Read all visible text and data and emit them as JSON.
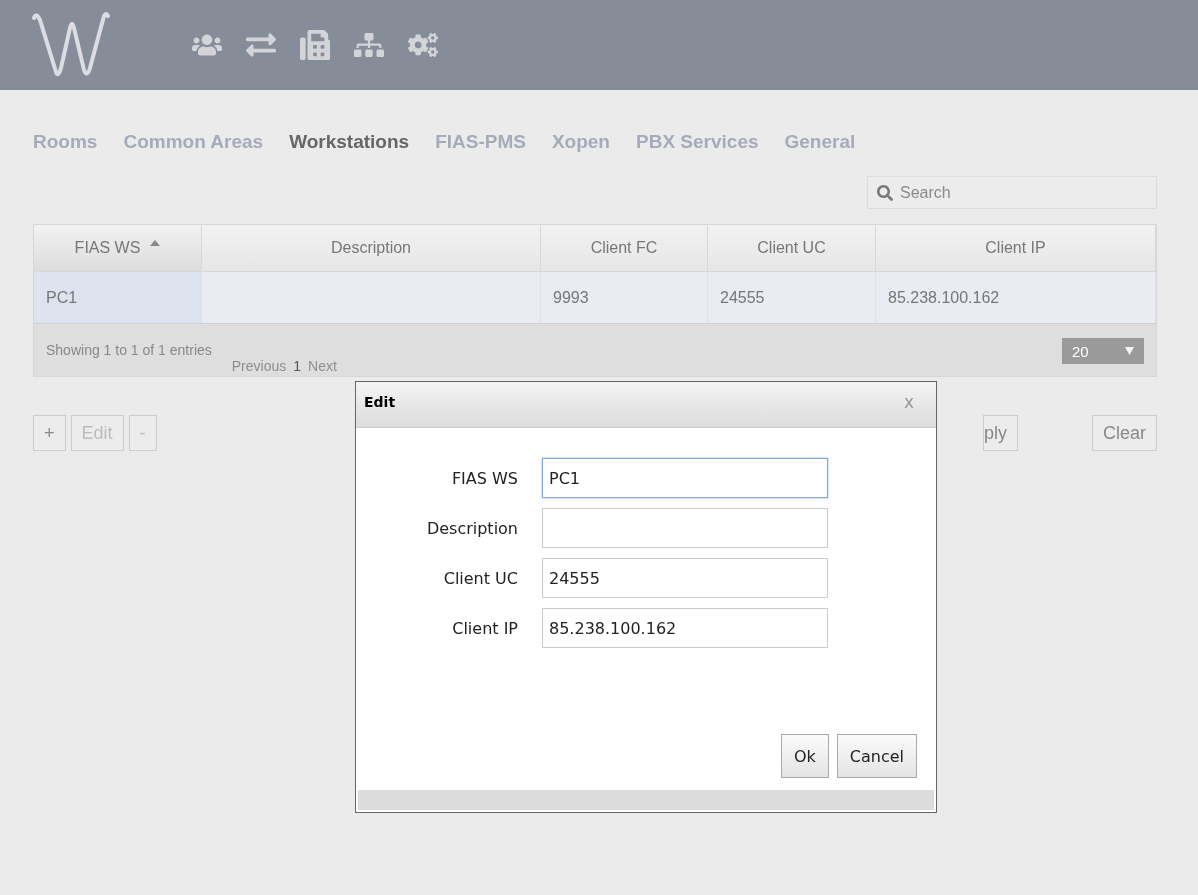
{
  "tabs": [
    {
      "label": "Rooms",
      "selected": false
    },
    {
      "label": "Common Areas",
      "selected": false
    },
    {
      "label": "Workstations",
      "selected": true
    },
    {
      "label": "FIAS-PMS",
      "selected": false
    },
    {
      "label": "Xopen",
      "selected": false
    },
    {
      "label": "PBX Services",
      "selected": false
    },
    {
      "label": "General",
      "selected": false
    }
  ],
  "search": {
    "placeholder": "Search"
  },
  "table": {
    "columns": [
      {
        "label": "FIAS WS",
        "sorted": true
      },
      {
        "label": "Description",
        "sorted": false
      },
      {
        "label": "Client FC",
        "sorted": false
      },
      {
        "label": "Client UC",
        "sorted": false
      },
      {
        "label": "Client IP",
        "sorted": false
      }
    ],
    "rows": [
      {
        "cells": [
          "PC1",
          null,
          "9993",
          "24555",
          "85.238.100.162"
        ],
        "selected": false
      }
    ],
    "info": "Showing 1 to 1 of 1 entries",
    "pagination": [
      {
        "label": "Previous",
        "disabled": true
      },
      {
        "label": "1",
        "disabled": false
      },
      {
        "label": "Next",
        "disabled": true
      }
    ],
    "page_size": "20"
  },
  "buttons": [
    {
      "label": "+",
      "disabled": false
    },
    {
      "label": "Edit",
      "disabled": true
    },
    {
      "label": "-",
      "disabled": true
    }
  ],
  "right_buttons": [
    {
      "label": "ply",
      "disabled": false
    },
    {
      "label": "Clear",
      "disabled": false
    }
  ],
  "dialog": {
    "title": "Edit",
    "close": "x",
    "fields": [
      {
        "label": "FIAS WS",
        "value": "PC1",
        "focused": true
      },
      {
        "label": "Description",
        "focused": false
      },
      {
        "label": "Client UC",
        "value": "24555",
        "focused": false
      },
      {
        "label": "Client IP",
        "value": "85.238.100.162",
        "focused": false
      }
    ],
    "buttons": [
      "Ok",
      "Cancel"
    ]
  }
}
